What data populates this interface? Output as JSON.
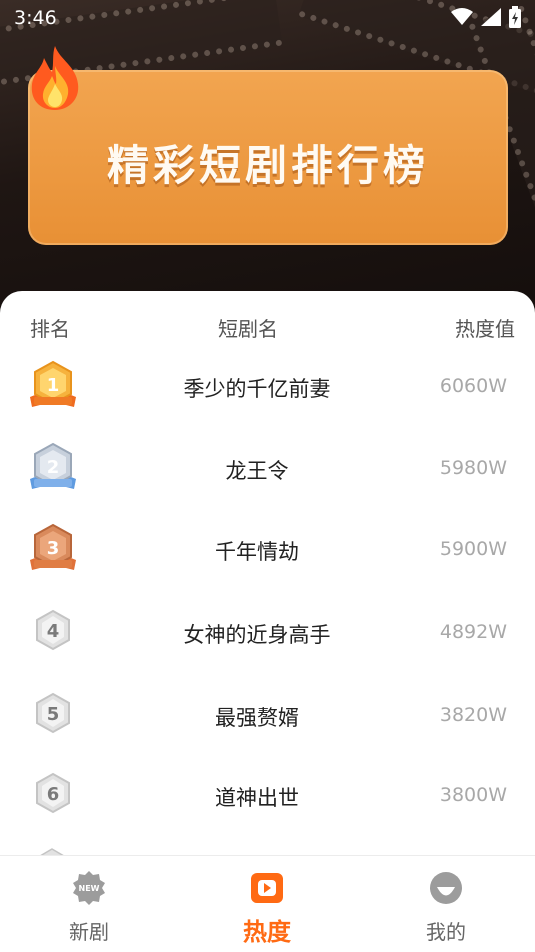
{
  "status": {
    "time": "3:46"
  },
  "banner": {
    "title": "精彩短剧排行榜"
  },
  "table": {
    "headers": {
      "rank": "排名",
      "name": "短剧名",
      "heat": "热度值"
    },
    "rows": [
      {
        "rank": "1",
        "name": "季少的千亿前妻",
        "heat": "6060W"
      },
      {
        "rank": "2",
        "name": "龙王令",
        "heat": "5980W"
      },
      {
        "rank": "3",
        "name": "千年情劫",
        "heat": "5900W"
      },
      {
        "rank": "4",
        "name": "女神的近身高手",
        "heat": "4892W"
      },
      {
        "rank": "5",
        "name": "最强赘婿",
        "heat": "3820W"
      },
      {
        "rank": "6",
        "name": "道神出世",
        "heat": "3800W"
      }
    ]
  },
  "tabs": [
    {
      "label": "新剧",
      "badge": "NEW",
      "icon": "new-flower-icon"
    },
    {
      "label": "热度",
      "icon": "play-icon"
    },
    {
      "label": "我的",
      "icon": "profile-icon"
    }
  ],
  "colors": {
    "accent": "#ff6a13",
    "banner": "#f0a04a"
  }
}
